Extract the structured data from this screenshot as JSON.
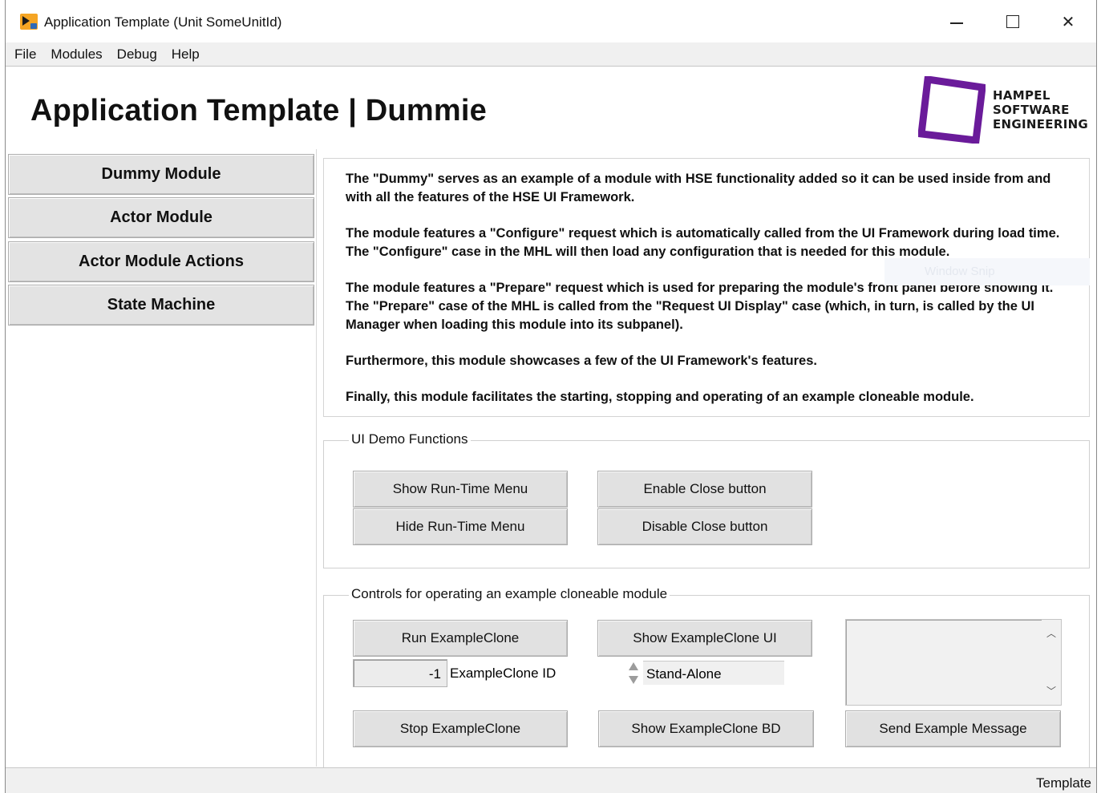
{
  "window": {
    "title": "Application Template (Unit SomeUnitId)",
    "controls": {
      "minimize": "minimize",
      "maximize": "maximize",
      "close": "✕"
    }
  },
  "menu": [
    "File",
    "Modules",
    "Debug",
    "Help"
  ],
  "header": {
    "title": "Application Template | Dummie",
    "logo_lines": [
      "HAMPEL",
      "SOFTWARE",
      "ENGINEERING"
    ],
    "logo_color": "#6a1b9a"
  },
  "sidebar": {
    "items": [
      {
        "label": "Dummy Module"
      },
      {
        "label": "Actor Module"
      },
      {
        "label": "Actor Module Actions"
      },
      {
        "label": "State Machine"
      }
    ]
  },
  "description": {
    "paragraphs": [
      "The \"Dummy\" serves as an example of a module with HSE functionality added so it can be used inside from and with all the features of the HSE UI Framework.",
      "The module features a \"Configure\" request which is automatically called from the UI Framework during load time. The \"Configure\" case in the MHL will then load any configuration that is needed for this module.",
      "The module features a \"Prepare\" request which is used for preparing the module's front panel before showing it. The \"Prepare\" case of the MHL is called from the \"Request UI Display\" case (which, in turn, is called by the UI Manager when loading this module into its subpanel).",
      "Furthermore, this module showcases a few of the UI Framework's features.",
      "Finally, this module facilitates the starting, stopping and  operating of an example cloneable module."
    ],
    "watermark": "Window Snip"
  },
  "ui_demo": {
    "label": "UI Demo Functions",
    "show_menu": "Show Run-Time Menu",
    "hide_menu": "Hide Run-Time Menu",
    "enable_close": "Enable Close button",
    "disable_close": "Disable Close button"
  },
  "clone_controls": {
    "label": "Controls for operating an example cloneable module",
    "run": "Run ExampleClone",
    "show_ui": "Show ExampleClone UI",
    "stop": "Stop ExampleClone",
    "show_bd": "Show ExampleClone BD",
    "send": "Send Example Message",
    "clone_id_value": "-1",
    "clone_id_label": "ExampleClone ID",
    "mode_value": "Stand-Alone",
    "message_text": ""
  },
  "status": {
    "text": "Template"
  }
}
